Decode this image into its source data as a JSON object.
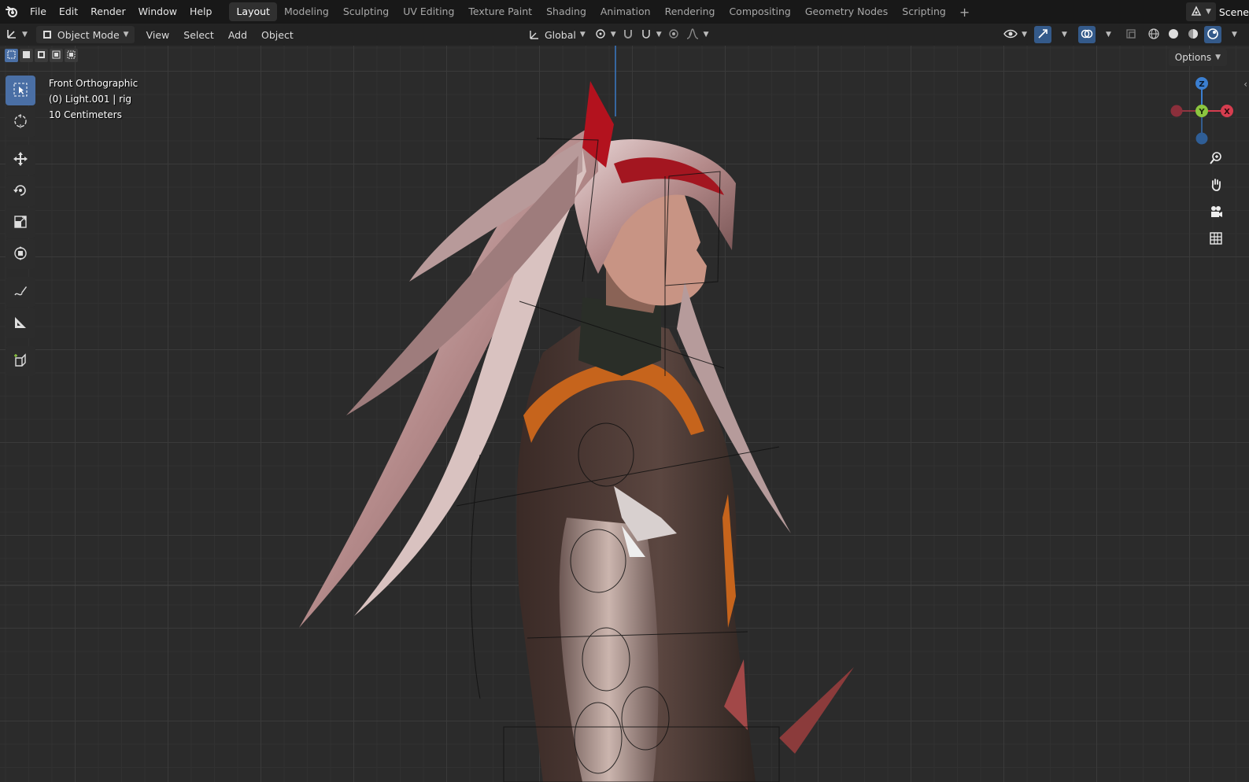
{
  "topbar": {
    "menus": [
      "File",
      "Edit",
      "Render",
      "Window",
      "Help"
    ],
    "workspaces": [
      "Layout",
      "Modeling",
      "Sculpting",
      "UV Editing",
      "Texture Paint",
      "Shading",
      "Animation",
      "Rendering",
      "Compositing",
      "Geometry Nodes",
      "Scripting"
    ],
    "active_workspace": "Layout",
    "add_workspace": "+",
    "scene_label": "Scene"
  },
  "header": {
    "mode": "Object Mode",
    "menus": [
      "View",
      "Select",
      "Add",
      "Object"
    ],
    "orientation": "Global"
  },
  "viewport": {
    "view_name": "Front Orthographic",
    "active_object": "(0) Light.001 | rig",
    "grid_scale": "10 Centimeters",
    "options_label": "Options",
    "gizmo": {
      "z": "Z",
      "y": "Y",
      "x": "X"
    }
  },
  "colors": {
    "accent": "#4a6fa5",
    "axis_x": "#d63d4f",
    "axis_y": "#8cc63f",
    "axis_z": "#3b7fd1",
    "grid_major": "#3a3a3a",
    "background": "#2b2b2b"
  },
  "icons": {
    "toolbar": [
      "select-box-icon",
      "cursor-icon",
      "move-icon",
      "rotate-icon",
      "scale-icon",
      "transform-icon",
      "annotate-icon",
      "measure-icon",
      "add-cube-icon"
    ],
    "nav": [
      "zoom-icon",
      "pan-hand-icon",
      "camera-icon",
      "grid-perspective-icon"
    ]
  }
}
